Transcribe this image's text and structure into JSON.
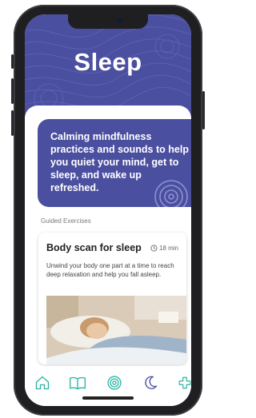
{
  "header": {
    "title": "Sleep"
  },
  "intro": {
    "text": "Calming mindfulness practices and sounds to help you quiet your mind, get to sleep, and wake up refreshed."
  },
  "section": {
    "label": "Guided Exercises"
  },
  "card": {
    "title": "Body scan for sleep",
    "duration": "18 min",
    "description": "Unwind your body one part at a time to reach deep relaxation and help you fall asleep."
  },
  "tabbar": {
    "items": [
      {
        "icon": "home-icon"
      },
      {
        "icon": "book-icon"
      },
      {
        "icon": "spiral-icon"
      },
      {
        "icon": "moon-icon"
      },
      {
        "icon": "plus-icon"
      }
    ]
  },
  "colors": {
    "brand": "#4b4fa0",
    "accent": "#2bb5a3"
  }
}
